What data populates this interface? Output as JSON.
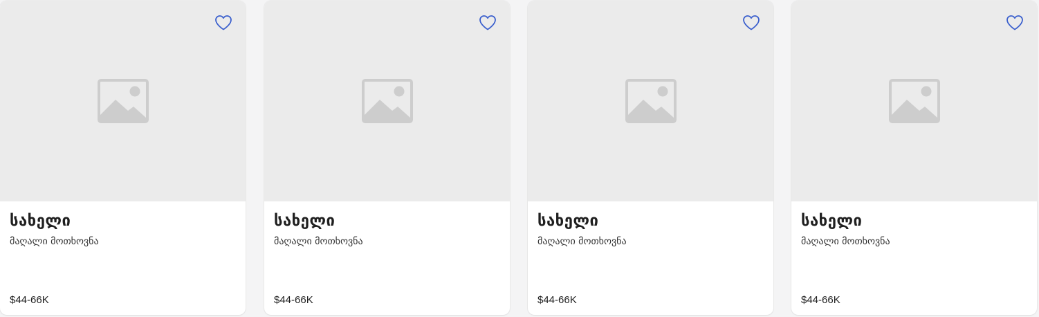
{
  "colors": {
    "accent": "#3a5fcd",
    "placeholder_bg": "#ebebeb",
    "placeholder_icon": "#cdcdcd"
  },
  "cards": [
    {
      "title": "სახელი",
      "subtitle": "მაღალი მოთხოვნა",
      "price": "$44-66K",
      "image_icon": "image-placeholder-icon",
      "favorite_icon": "heart-outline-icon"
    },
    {
      "title": "სახელი",
      "subtitle": "მაღალი მოთხოვნა",
      "price": "$44-66K",
      "image_icon": "image-placeholder-icon",
      "favorite_icon": "heart-outline-icon"
    },
    {
      "title": "სახელი",
      "subtitle": "მაღალი მოთხოვნა",
      "price": "$44-66K",
      "image_icon": "image-placeholder-icon",
      "favorite_icon": "heart-outline-icon"
    },
    {
      "title": "სახელი",
      "subtitle": "მაღალი მოთხოვნა",
      "price": "$44-66K",
      "image_icon": "image-placeholder-icon",
      "favorite_icon": "heart-outline-icon"
    }
  ]
}
